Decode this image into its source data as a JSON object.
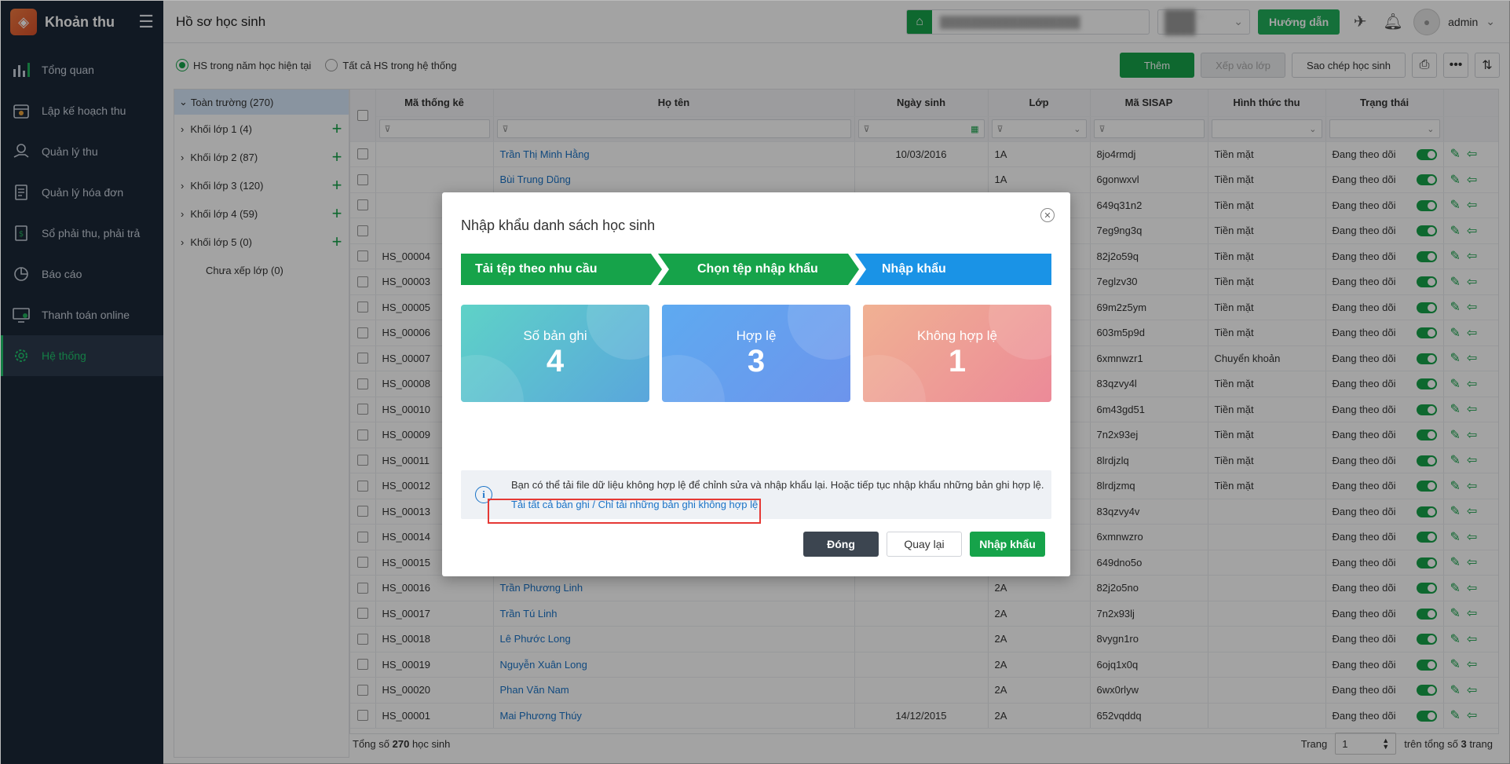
{
  "app": {
    "title": "Khoản thu"
  },
  "sidebar": {
    "items": [
      {
        "label": "Tổng quan",
        "icon": "bar-chart-icon"
      },
      {
        "label": "Lập kế hoạch thu",
        "icon": "calendar-money-icon"
      },
      {
        "label": "Quản lý thu",
        "icon": "money-hand-icon"
      },
      {
        "label": "Quản lý hóa đơn",
        "icon": "invoice-icon"
      },
      {
        "label": "Sổ phải thu, phải trả",
        "icon": "ledger-icon"
      },
      {
        "label": "Báo cáo",
        "icon": "pie-chart-icon"
      },
      {
        "label": "Thanh toán online",
        "icon": "online-payment-icon"
      },
      {
        "label": "Hệ thống",
        "icon": "gear-icon",
        "active": true
      }
    ]
  },
  "header": {
    "title": "Hồ sơ học sinh",
    "guide_label": "Hướng dẫn",
    "user": "admin"
  },
  "toolbar": {
    "radio_current": "HS trong năm học hiện tại",
    "radio_all": "Tất cả HS trong hệ thống",
    "add_label": "Thêm",
    "assign_label": "Xếp vào lớp",
    "copy_label": "Sao chép học sinh"
  },
  "tree": {
    "root": "Toàn trường (270)",
    "nodes": [
      "Khối lớp 1 (4)",
      "Khối lớp 2 (87)",
      "Khối lớp 3 (120)",
      "Khối lớp 4 (59)",
      "Khối lớp 5 (0)"
    ],
    "unassigned": "Chưa xếp lớp (0)"
  },
  "grid": {
    "columns": [
      "Mã thống kê",
      "Họ tên",
      "Ngày sinh",
      "Lớp",
      "Mã SISAP",
      "Hình thức thu",
      "Trạng thái"
    ],
    "rows": [
      [
        "",
        "Trần Thị Minh Hằng",
        "10/03/2016",
        "1A",
        "8jo4rmdj",
        "Tiền mặt",
        "Đang theo dõi"
      ],
      [
        "",
        "Bùi Trung Dũng",
        "",
        "1A",
        "6gonwxvl",
        "Tiền mặt",
        "Đang theo dõi"
      ],
      [
        "",
        "",
        "",
        "",
        "649q31n2",
        "Tiền mặt",
        "Đang theo dõi"
      ],
      [
        "",
        "",
        "",
        "",
        "7eg9ng3q",
        "Tiền mặt",
        "Đang theo dõi"
      ],
      [
        "HS_00004",
        "",
        "",
        "",
        "82j2o59q",
        "Tiền mặt",
        "Đang theo dõi"
      ],
      [
        "HS_00003",
        "",
        "",
        "",
        "7eglzv30",
        "Tiền mặt",
        "Đang theo dõi"
      ],
      [
        "HS_00005",
        "",
        "",
        "",
        "69m2z5ym",
        "Tiền mặt",
        "Đang theo dõi"
      ],
      [
        "HS_00006",
        "",
        "",
        "",
        "603m5p9d",
        "Tiền mặt",
        "Đang theo dõi"
      ],
      [
        "HS_00007",
        "",
        "",
        "",
        "6xmnwzr1",
        "Chuyển khoản",
        "Đang theo dõi"
      ],
      [
        "HS_00008",
        "",
        "",
        "",
        "83qzvy4l",
        "Tiền mặt",
        "Đang theo dõi"
      ],
      [
        "HS_00010",
        "",
        "",
        "",
        "6m43gd51",
        "Tiền mặt",
        "Đang theo dõi"
      ],
      [
        "HS_00009",
        "",
        "",
        "",
        "7n2x93ej",
        "Tiền mặt",
        "Đang theo dõi"
      ],
      [
        "HS_00011",
        "",
        "",
        "",
        "8lrdjzlq",
        "Tiền mặt",
        "Đang theo dõi"
      ],
      [
        "HS_00012",
        "",
        "",
        "",
        "8lrdjzmq",
        "Tiền mặt",
        "Đang theo dõi"
      ],
      [
        "HS_00013",
        "",
        "",
        "",
        "83qzvy4v",
        "",
        "Đang theo dõi"
      ],
      [
        "HS_00014",
        "",
        "",
        "",
        "6xmnwzro",
        "",
        "Đang theo dõi"
      ],
      [
        "HS_00015",
        "",
        "",
        "",
        "649dno5o",
        "",
        "Đang theo dõi"
      ],
      [
        "HS_00016",
        "Trần Phương Linh",
        "",
        "2A",
        "82j2o5no",
        "",
        "Đang theo dõi"
      ],
      [
        "HS_00017",
        "Trần Tú Linh",
        "",
        "2A",
        "7n2x93lj",
        "",
        "Đang theo dõi"
      ],
      [
        "HS_00018",
        "Lê Phước Long",
        "",
        "2A",
        "8vygn1ro",
        "",
        "Đang theo dõi"
      ],
      [
        "HS_00019",
        "Nguyễn Xuân Long",
        "",
        "2A",
        "6ojq1x0q",
        "",
        "Đang theo dõi"
      ],
      [
        "HS_00020",
        "Phan Văn Nam",
        "",
        "2A",
        "6wx0rlyw",
        "",
        "Đang theo dõi"
      ],
      [
        "HS_00001",
        "Mai Phương Thúy",
        "14/12/2015",
        "2A",
        "652vqddq",
        "",
        "Đang theo dõi"
      ]
    ]
  },
  "footer": {
    "total_prefix": "Tổng số",
    "total_count": "270",
    "total_suffix": "học sinh",
    "page_label": "Trang",
    "page_value": "1",
    "of_total_prefix": "trên tổng số",
    "of_total_count": "3",
    "of_total_suffix": "trang"
  },
  "modal": {
    "title": "Nhập khẩu danh sách học sinh",
    "steps": [
      "Tải tệp theo nhu cầu",
      "Chọn tệp nhập khẩu",
      "Nhập khẩu"
    ],
    "cards": [
      {
        "label": "Số bản ghi",
        "value": "4"
      },
      {
        "label": "Hợp lệ",
        "value": "3"
      },
      {
        "label": "Không hợp lệ",
        "value": "1"
      }
    ],
    "note_text": "Bạn có thể tải file dữ liệu không hợp lệ để chỉnh sửa và nhập khẩu lại. Hoặc tiếp tục nhập khẩu những bản ghi hợp lệ.",
    "note_link": "Tải tất cả bản ghi / Chỉ tải những bản ghi không hợp lệ",
    "close_label": "Đóng",
    "back_label": "Quay lại",
    "import_label": "Nhập khẩu"
  },
  "colors": {
    "primary": "#16a34a",
    "step_active": "#1a93e6",
    "sidebar_bg": "#1c2838",
    "highlight": "#e53935"
  }
}
